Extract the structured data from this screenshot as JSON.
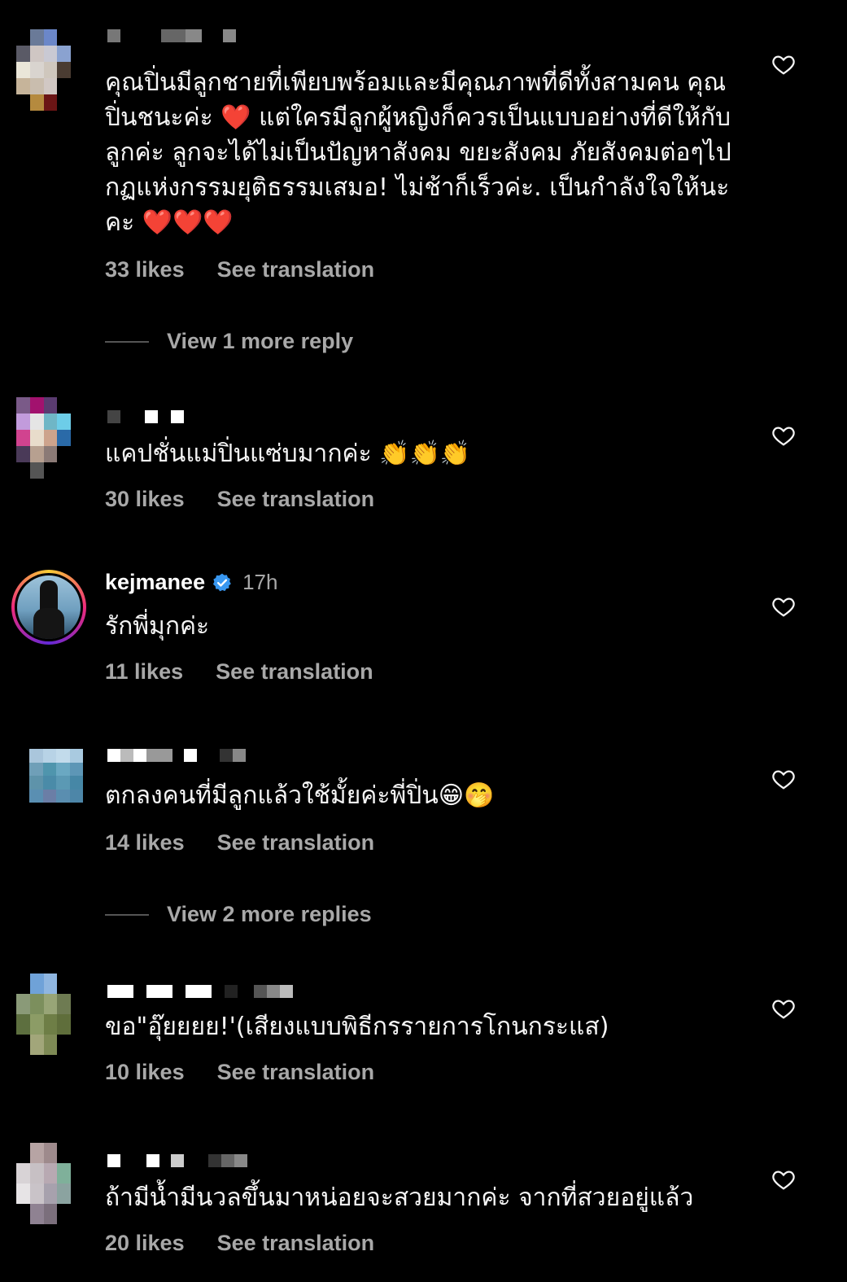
{
  "comments": [
    {
      "text": "คุณปิ่นมีลูกชายที่เพียบพร้อมและมีคุณภาพที่ดีทั้งสามคน คุณปิ่นชนะค่ะ ❤️ แต่ใครมีลูกผู้หญิงก็ควรเป็นแบบอย่างที่ดีให้กับลูกค่ะ ลูกจะได้ไม่เป็นปัญหาสังคม ขยะสังคม ภัยสังคมต่อๆไป กฏแห่งกรรมยุติธรรมเสมอ! ไม่ช้าก็เร็วค่ะ. เป็นกำลังใจให้นะคะ ❤️❤️❤️",
      "likes": "33 likes",
      "translate": "See translation",
      "replies": "View 1 more reply"
    },
    {
      "text": "แคปชั่นแม่ปิ่นแซ่บมากค่ะ 👏👏👏",
      "likes": "30 likes",
      "translate": "See translation"
    },
    {
      "username": "kejmanee",
      "time": "17h",
      "text": "รักพี่มุกค่ะ",
      "likes": "11 likes",
      "translate": "See translation"
    },
    {
      "text": "ตกลงคนที่มีลูกแล้วใช้มั้ยค่ะพี่ปิ่น😁🤭",
      "likes": "14 likes",
      "translate": "See translation",
      "replies": "View 2 more replies"
    },
    {
      "text": "ขอ\"อุ๊ยยยย!'(เสียงแบบพิธีกรรายการโกนกระแส)",
      "likes": "10 likes",
      "translate": "See translation"
    },
    {
      "text": "ถ้ามีน้ำมีนวลขึ้นมาหน่อยจะสวยมากค่ะ จากที่สวยอยู่แล้ว",
      "likes": "20 likes",
      "translate": "See translation"
    }
  ],
  "icons": {
    "heart": "heart-outline-icon",
    "verified": "verified-badge-icon"
  },
  "colors": {
    "background": "#000000",
    "text": "#f5f5f5",
    "muted": "#a8a8a8",
    "verified": "#3897f0"
  }
}
